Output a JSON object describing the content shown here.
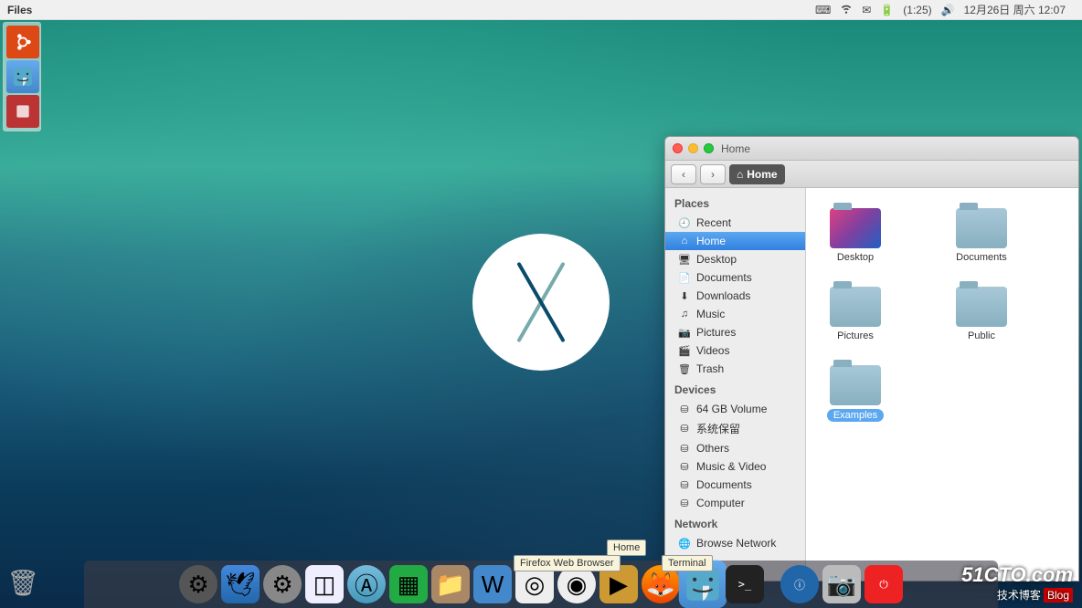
{
  "menubar": {
    "app": "Files",
    "battery": "(1:25)",
    "date": "12月26日 周六 12:07"
  },
  "window": {
    "title": "Home",
    "breadcrumb": "Home",
    "sidebar": {
      "places_head": "Places",
      "places": [
        {
          "icon": "clock",
          "label": "Recent"
        },
        {
          "icon": "home",
          "label": "Home",
          "selected": true
        },
        {
          "icon": "desktop",
          "label": "Desktop"
        },
        {
          "icon": "doc",
          "label": "Documents"
        },
        {
          "icon": "download",
          "label": "Downloads"
        },
        {
          "icon": "music",
          "label": "Music"
        },
        {
          "icon": "pictures",
          "label": "Pictures"
        },
        {
          "icon": "video",
          "label": "Videos"
        },
        {
          "icon": "trash",
          "label": "Trash"
        }
      ],
      "devices_head": "Devices",
      "devices": [
        {
          "icon": "disk",
          "label": "64 GB Volume"
        },
        {
          "icon": "disk",
          "label": "系统保留"
        },
        {
          "icon": "disk",
          "label": "Others"
        },
        {
          "icon": "disk",
          "label": "Music & Video"
        },
        {
          "icon": "disk",
          "label": "Documents"
        },
        {
          "icon": "disk",
          "label": "Computer"
        }
      ],
      "network_head": "Network",
      "network": [
        {
          "icon": "net",
          "label": "Browse Network"
        }
      ]
    },
    "folders": [
      {
        "label": "Desktop",
        "type": "desk"
      },
      {
        "label": "Documents",
        "type": "folder"
      },
      {
        "label": "Pictures",
        "type": "folder"
      },
      {
        "label": "Public",
        "type": "folder"
      },
      {
        "label": "Examples",
        "type": "folder",
        "selected": true
      }
    ]
  },
  "tooltips": {
    "home": "Home",
    "firefox": "Firefox Web Browser",
    "terminal": "Terminal"
  },
  "watermark": {
    "big": "51CTO.com",
    "small": "技术博客",
    "tag": "Blog"
  }
}
